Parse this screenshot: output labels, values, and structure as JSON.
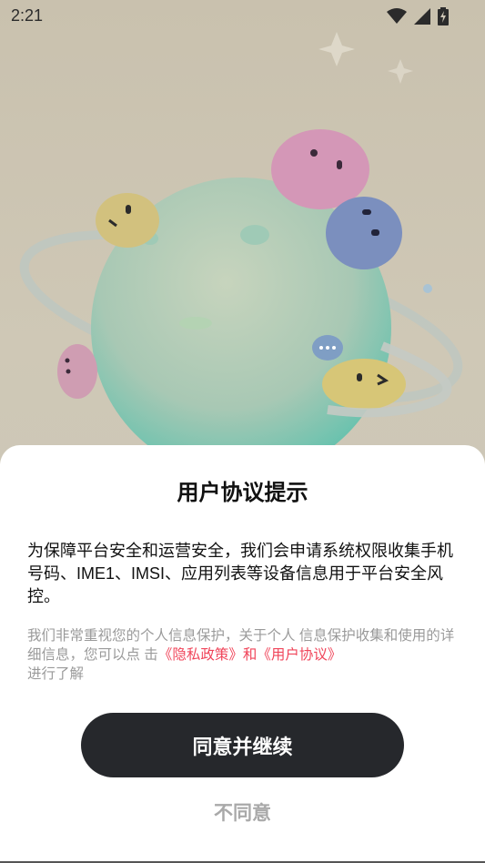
{
  "status_bar": {
    "time": "2:21",
    "icons": [
      "wifi-icon",
      "cellular-signal-icon",
      "battery-charging-icon"
    ]
  },
  "illustration": {
    "description_icon": "planet-mascots-illustration"
  },
  "dialog": {
    "title": "用户协议提示",
    "body": "为保障平台安全和运营安全，我们会申请系统权限收集手机号码、IME1、IMSI、应用列表等设备信息用于平台安全风控。",
    "note_prefix": "我们非常重视您的个人信息保护，关于个人 信息保护收集和使用的详细信息，您可以点 击",
    "note_link": "《隐私政策》和《用户协议》",
    "note_suffix": "进行了解",
    "agree_label": "同意并继续",
    "disagree_label": "不同意"
  },
  "colors": {
    "link": "#f0455a",
    "primary_button": "#26282c",
    "secondary_text": "#a9a9a9"
  }
}
